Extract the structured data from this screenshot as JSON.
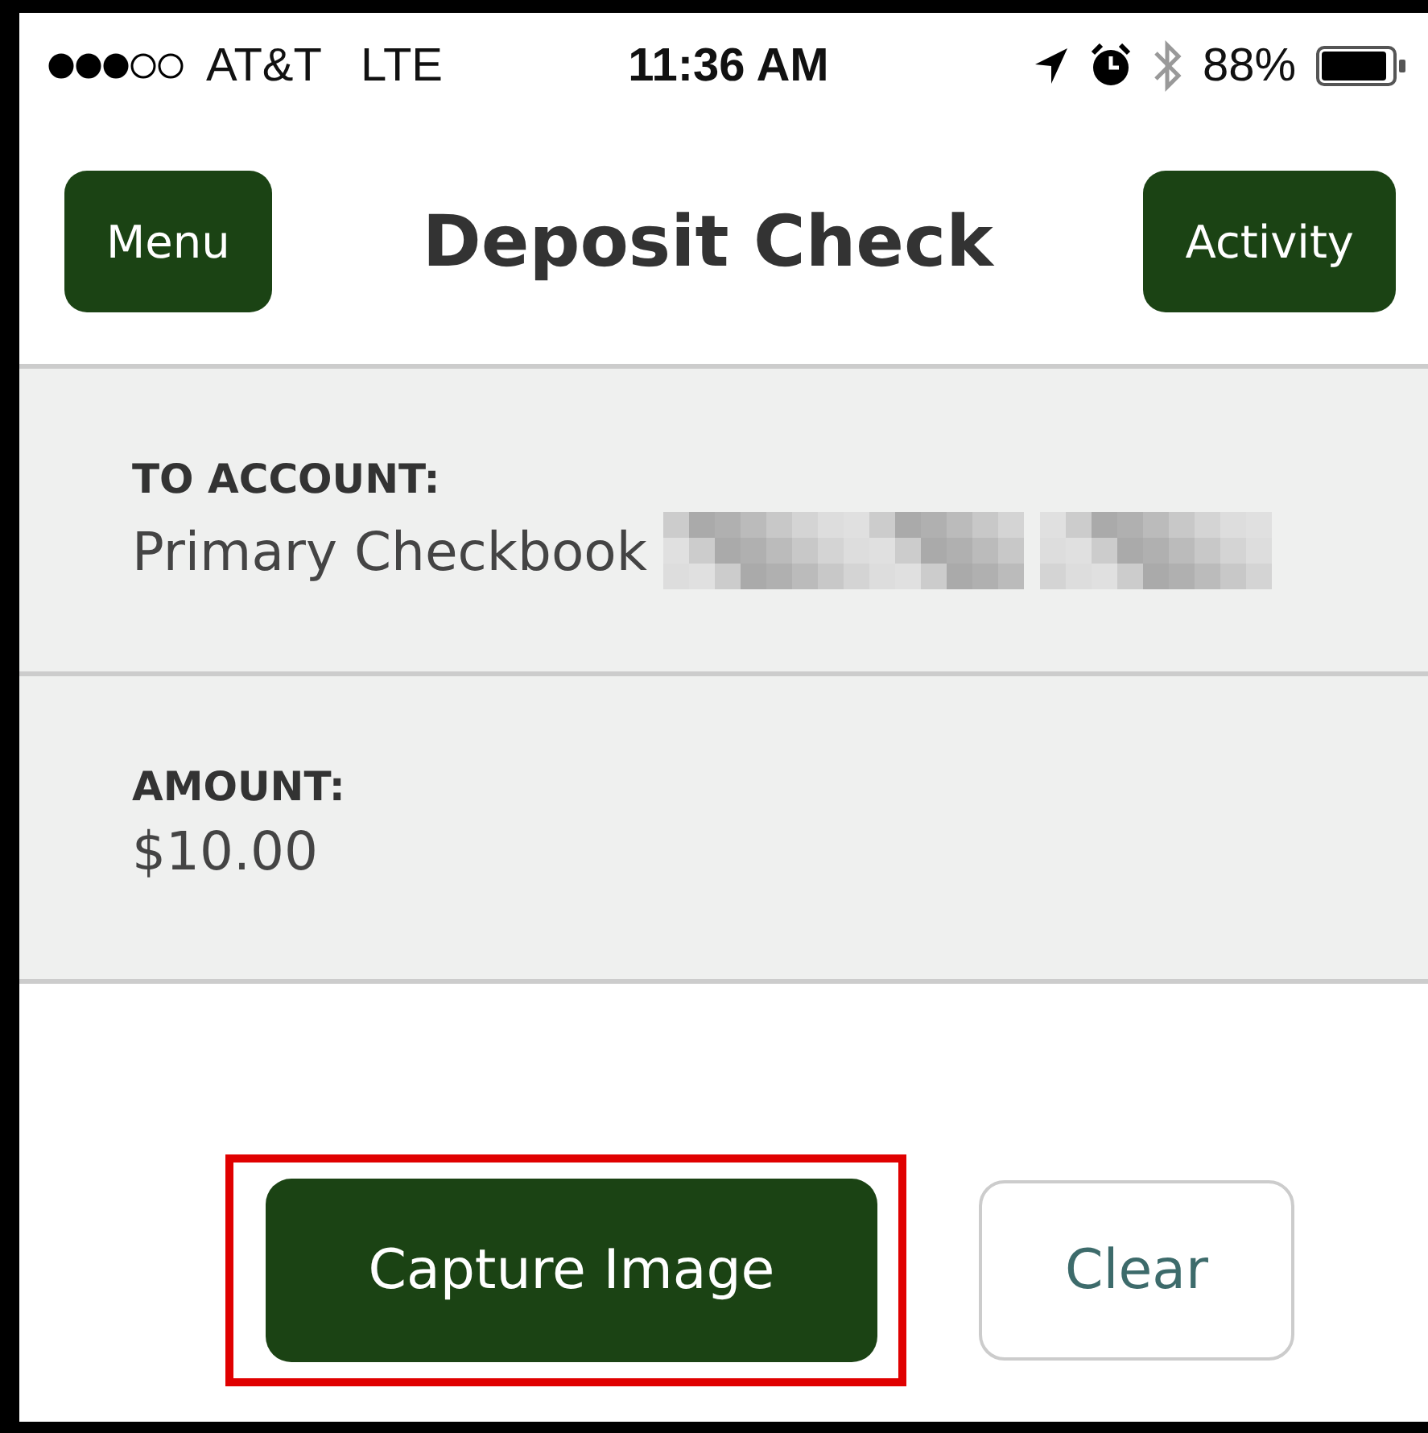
{
  "status_bar": {
    "carrier": "AT&T",
    "network": "LTE",
    "time": "11:36 AM",
    "battery": "88%"
  },
  "header": {
    "title": "Deposit Check",
    "left_button": "Menu",
    "right_button": "Activity"
  },
  "fields": [
    {
      "label": "TO ACCOUNT:",
      "value": "Primary Checkbook",
      "redacted": true
    },
    {
      "label": "AMOUNT:",
      "value": "$10.00",
      "redacted": false
    }
  ],
  "buttons": [
    {
      "label": "Capture Image",
      "kind": "primary",
      "highlighted": true
    },
    {
      "label": "Clear",
      "kind": "secondary",
      "highlighted": false
    }
  ]
}
